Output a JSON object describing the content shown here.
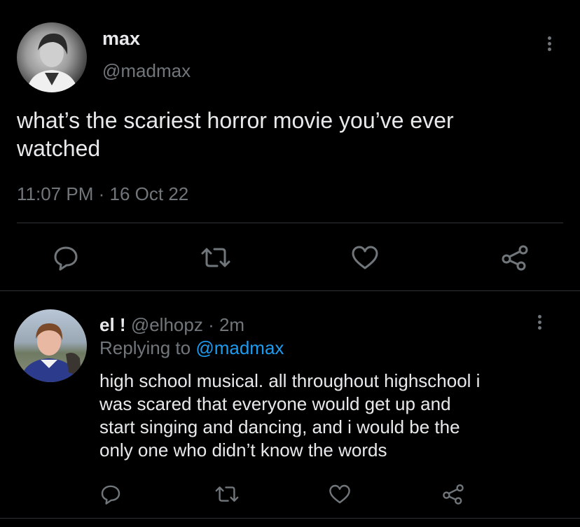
{
  "main_tweet": {
    "display_name": "max",
    "handle": "@madmax",
    "text_line1": "what’s the scariest horror movie you’ve ever",
    "text_line2": "watched",
    "time": "11:07 PM",
    "separator": "·",
    "date": "16 Oct 22"
  },
  "reply": {
    "display_name": "el !",
    "handle": "@elhopz",
    "separator": "·",
    "age": "2m",
    "replying_prefix": "Replying to",
    "replying_to": "@madmax",
    "lines": [
      "high school musical. all throughout highschool i",
      "was scared that everyone would get up and",
      "start singing and dancing, and i would be the",
      "only one who didn’t know the words"
    ]
  },
  "icons": {
    "reply": "comment-icon",
    "retweet": "retweet-icon",
    "like": "heart-icon",
    "share": "share-icon",
    "more": "more-vertical-icon"
  },
  "colors": {
    "background": "#000000",
    "text": "#e7e9ea",
    "muted": "#71767b",
    "link": "#1d9bf0",
    "divider": "#2f3336"
  }
}
